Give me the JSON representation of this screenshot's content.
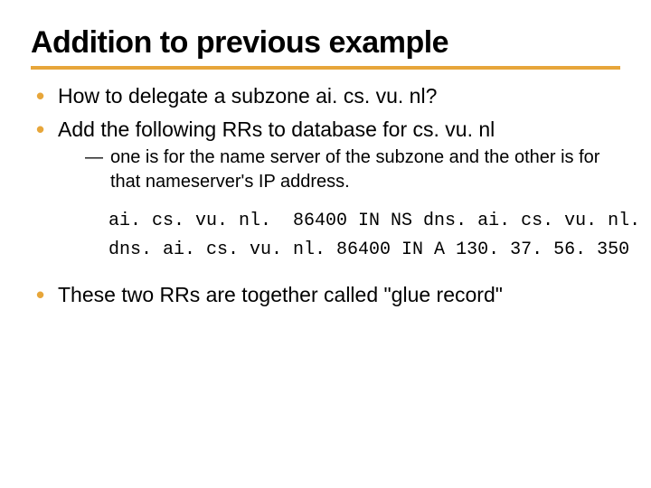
{
  "title": "Addition to previous example",
  "b1": "How to delegate a subzone ai. cs. vu. nl?",
  "b2": "Add the following RRs to database for cs. vu. nl",
  "sub1": "one is for the name server of the subzone and the other is for that nameserver's IP address.",
  "code": "ai. cs. vu. nl.  86400 IN NS dns. ai. cs. vu. nl.\ndns. ai. cs. vu. nl. 86400 IN A 130. 37. 56. 350",
  "b3": "These two RRs are together called \"glue record\""
}
